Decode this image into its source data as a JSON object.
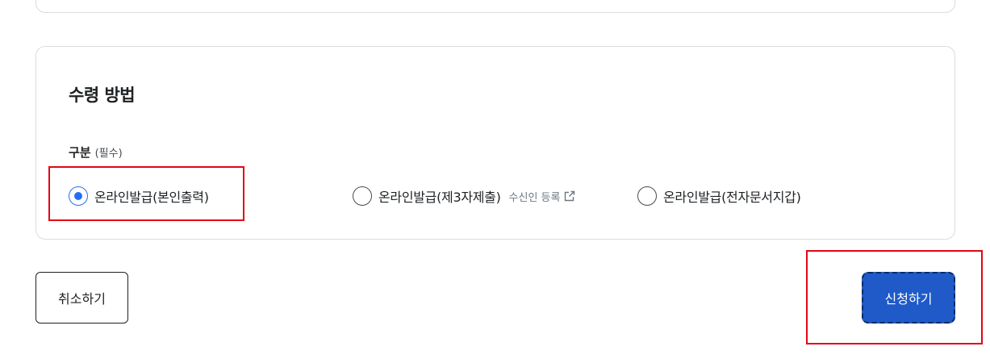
{
  "section": {
    "title": "수령 방법",
    "field_label": "구분",
    "field_required": "(필수)"
  },
  "receive_options": [
    {
      "label": "온라인발급(본인출력)",
      "selected": true
    },
    {
      "label": "온라인발급(제3자제출)",
      "selected": false,
      "link": "수신인 등록",
      "link_icon": "external-link-icon"
    },
    {
      "label": "온라인발급(전자문서지갑)",
      "selected": false
    }
  ],
  "actions": {
    "cancel_label": "취소하기",
    "submit_label": "신청하기"
  },
  "colors": {
    "accent": "#256ef4",
    "submit_bg": "#1f5ac8",
    "highlight": "#e30613",
    "border": "#d9dce0"
  }
}
